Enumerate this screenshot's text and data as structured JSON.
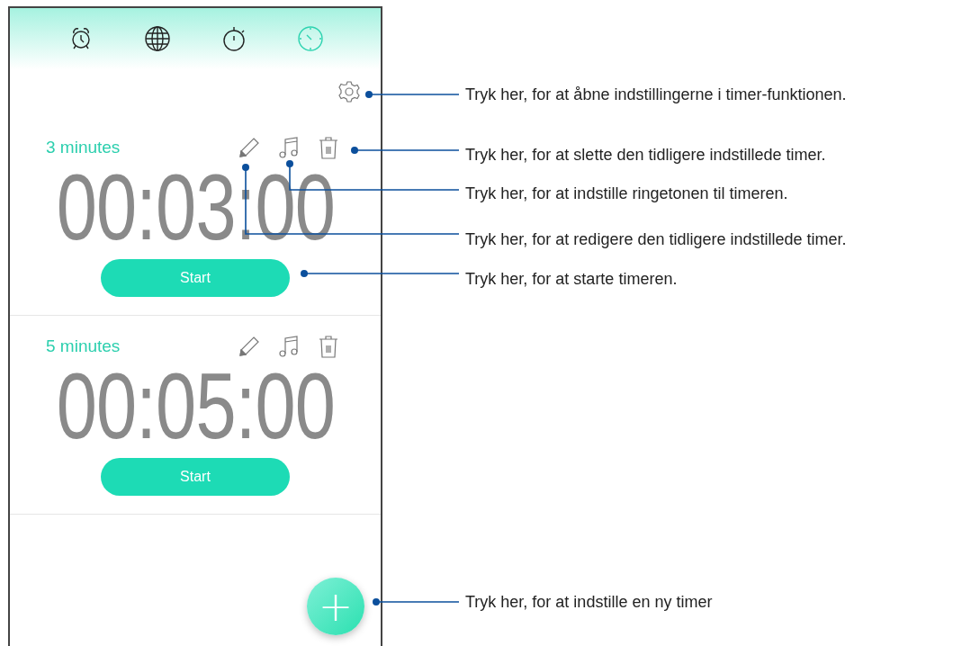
{
  "tabs": [
    {
      "kind": "alarm",
      "selected": false
    },
    {
      "kind": "world",
      "selected": false
    },
    {
      "kind": "stopwatch",
      "selected": false
    },
    {
      "kind": "timer",
      "selected": true
    }
  ],
  "timers": [
    {
      "label": "3 minutes",
      "time": "00:03:00",
      "button": "Start"
    },
    {
      "label": "5 minutes",
      "time": "00:05:00",
      "button": "Start"
    }
  ],
  "add_button": "+",
  "callouts": [
    "Tryk her, for at åbne indstillingerne i timer-funktionen.",
    "Tryk her, for at slette den tidligere indstillede timer.",
    "Tryk her, for at indstille ringetonen til timeren.",
    "Tryk her, for at redigere den tidligere indstillede timer.",
    "Tryk her, for at starte timeren.",
    "Tryk her, for at indstille en ny timer"
  ]
}
